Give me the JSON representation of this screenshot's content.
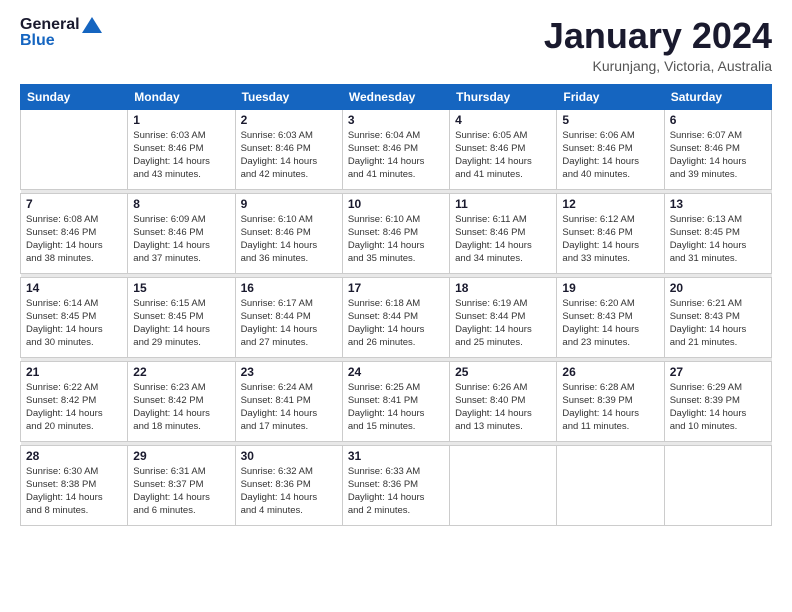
{
  "logo": {
    "line1": "General",
    "line2": "Blue"
  },
  "title": "January 2024",
  "subtitle": "Kurunjang, Victoria, Australia",
  "days_of_week": [
    "Sunday",
    "Monday",
    "Tuesday",
    "Wednesday",
    "Thursday",
    "Friday",
    "Saturday"
  ],
  "weeks": [
    [
      {
        "day": "",
        "info": ""
      },
      {
        "day": "1",
        "info": "Sunrise: 6:03 AM\nSunset: 8:46 PM\nDaylight: 14 hours\nand 43 minutes."
      },
      {
        "day": "2",
        "info": "Sunrise: 6:03 AM\nSunset: 8:46 PM\nDaylight: 14 hours\nand 42 minutes."
      },
      {
        "day": "3",
        "info": "Sunrise: 6:04 AM\nSunset: 8:46 PM\nDaylight: 14 hours\nand 41 minutes."
      },
      {
        "day": "4",
        "info": "Sunrise: 6:05 AM\nSunset: 8:46 PM\nDaylight: 14 hours\nand 41 minutes."
      },
      {
        "day": "5",
        "info": "Sunrise: 6:06 AM\nSunset: 8:46 PM\nDaylight: 14 hours\nand 40 minutes."
      },
      {
        "day": "6",
        "info": "Sunrise: 6:07 AM\nSunset: 8:46 PM\nDaylight: 14 hours\nand 39 minutes."
      }
    ],
    [
      {
        "day": "7",
        "info": "Sunrise: 6:08 AM\nSunset: 8:46 PM\nDaylight: 14 hours\nand 38 minutes."
      },
      {
        "day": "8",
        "info": "Sunrise: 6:09 AM\nSunset: 8:46 PM\nDaylight: 14 hours\nand 37 minutes."
      },
      {
        "day": "9",
        "info": "Sunrise: 6:10 AM\nSunset: 8:46 PM\nDaylight: 14 hours\nand 36 minutes."
      },
      {
        "day": "10",
        "info": "Sunrise: 6:10 AM\nSunset: 8:46 PM\nDaylight: 14 hours\nand 35 minutes."
      },
      {
        "day": "11",
        "info": "Sunrise: 6:11 AM\nSunset: 8:46 PM\nDaylight: 14 hours\nand 34 minutes."
      },
      {
        "day": "12",
        "info": "Sunrise: 6:12 AM\nSunset: 8:46 PM\nDaylight: 14 hours\nand 33 minutes."
      },
      {
        "day": "13",
        "info": "Sunrise: 6:13 AM\nSunset: 8:45 PM\nDaylight: 14 hours\nand 31 minutes."
      }
    ],
    [
      {
        "day": "14",
        "info": "Sunrise: 6:14 AM\nSunset: 8:45 PM\nDaylight: 14 hours\nand 30 minutes."
      },
      {
        "day": "15",
        "info": "Sunrise: 6:15 AM\nSunset: 8:45 PM\nDaylight: 14 hours\nand 29 minutes."
      },
      {
        "day": "16",
        "info": "Sunrise: 6:17 AM\nSunset: 8:44 PM\nDaylight: 14 hours\nand 27 minutes."
      },
      {
        "day": "17",
        "info": "Sunrise: 6:18 AM\nSunset: 8:44 PM\nDaylight: 14 hours\nand 26 minutes."
      },
      {
        "day": "18",
        "info": "Sunrise: 6:19 AM\nSunset: 8:44 PM\nDaylight: 14 hours\nand 25 minutes."
      },
      {
        "day": "19",
        "info": "Sunrise: 6:20 AM\nSunset: 8:43 PM\nDaylight: 14 hours\nand 23 minutes."
      },
      {
        "day": "20",
        "info": "Sunrise: 6:21 AM\nSunset: 8:43 PM\nDaylight: 14 hours\nand 21 minutes."
      }
    ],
    [
      {
        "day": "21",
        "info": "Sunrise: 6:22 AM\nSunset: 8:42 PM\nDaylight: 14 hours\nand 20 minutes."
      },
      {
        "day": "22",
        "info": "Sunrise: 6:23 AM\nSunset: 8:42 PM\nDaylight: 14 hours\nand 18 minutes."
      },
      {
        "day": "23",
        "info": "Sunrise: 6:24 AM\nSunset: 8:41 PM\nDaylight: 14 hours\nand 17 minutes."
      },
      {
        "day": "24",
        "info": "Sunrise: 6:25 AM\nSunset: 8:41 PM\nDaylight: 14 hours\nand 15 minutes."
      },
      {
        "day": "25",
        "info": "Sunrise: 6:26 AM\nSunset: 8:40 PM\nDaylight: 14 hours\nand 13 minutes."
      },
      {
        "day": "26",
        "info": "Sunrise: 6:28 AM\nSunset: 8:39 PM\nDaylight: 14 hours\nand 11 minutes."
      },
      {
        "day": "27",
        "info": "Sunrise: 6:29 AM\nSunset: 8:39 PM\nDaylight: 14 hours\nand 10 minutes."
      }
    ],
    [
      {
        "day": "28",
        "info": "Sunrise: 6:30 AM\nSunset: 8:38 PM\nDaylight: 14 hours\nand 8 minutes."
      },
      {
        "day": "29",
        "info": "Sunrise: 6:31 AM\nSunset: 8:37 PM\nDaylight: 14 hours\nand 6 minutes."
      },
      {
        "day": "30",
        "info": "Sunrise: 6:32 AM\nSunset: 8:36 PM\nDaylight: 14 hours\nand 4 minutes."
      },
      {
        "day": "31",
        "info": "Sunrise: 6:33 AM\nSunset: 8:36 PM\nDaylight: 14 hours\nand 2 minutes."
      },
      {
        "day": "",
        "info": ""
      },
      {
        "day": "",
        "info": ""
      },
      {
        "day": "",
        "info": ""
      }
    ]
  ]
}
